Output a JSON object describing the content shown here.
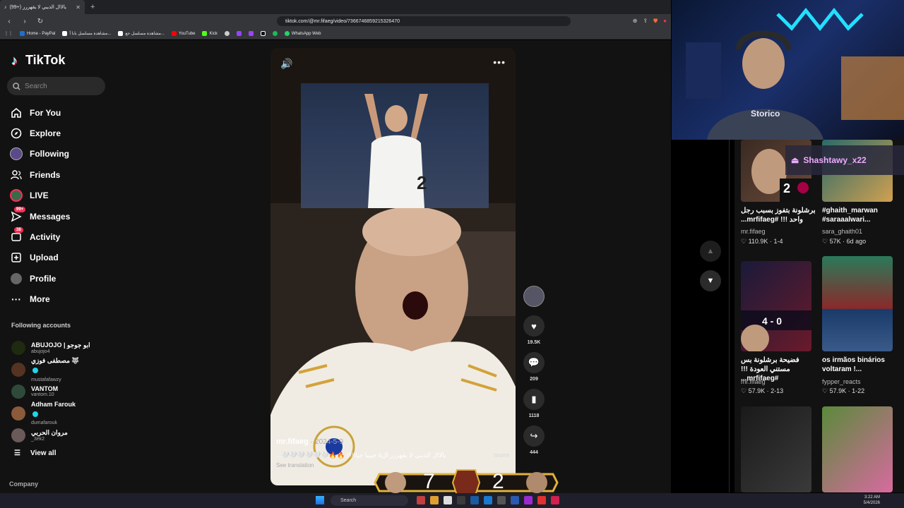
{
  "browser": {
    "tab_title": "(99+) يالاال الذيبي لا يقهررر",
    "url": "tiktok.com/@mr.fifaeg/video/7366746859215326470",
    "bookmarks": [
      "Home - PayPal",
      "مشاهدة مسلسل بابا أ...",
      "مشاهدة مسلسل جع...",
      "YouTube",
      "Kick",
      "WhatsApp Web"
    ]
  },
  "tiktok": {
    "logo_text": "TikTok",
    "search_placeholder": "Search",
    "nav": [
      {
        "label": "For You",
        "icon": "home-icon"
      },
      {
        "label": "Explore",
        "icon": "compass-icon"
      },
      {
        "label": "Following",
        "icon": "following-avatar-icon"
      },
      {
        "label": "Friends",
        "icon": "friends-icon"
      },
      {
        "label": "LIVE",
        "icon": "live-icon"
      },
      {
        "label": "Messages",
        "icon": "message-icon",
        "badge": "99+"
      },
      {
        "label": "Activity",
        "icon": "activity-icon",
        "badge": "38"
      },
      {
        "label": "Upload",
        "icon": "upload-icon"
      },
      {
        "label": "Profile",
        "icon": "profile-icon"
      },
      {
        "label": "More",
        "icon": "more-icon"
      }
    ],
    "following_title": "Following accounts",
    "following": [
      {
        "name": "ABUJOJO | ابو جوجو",
        "handle": "abujojo4",
        "verified": false,
        "color": "#1f2a10"
      },
      {
        "name": "مصطفى فوزي 🐺",
        "handle": "mustafafawzy",
        "verified": true,
        "color": "#553322"
      },
      {
        "name": "VANTOM",
        "handle": "vantom.10",
        "verified": false,
        "color": "#2f4a3a"
      },
      {
        "name": "Adham Farouk",
        "handle": "dumafarouk",
        "verified": true,
        "color": "#8a5a3a"
      },
      {
        "name": "مروان الحربي",
        "handle": "_3ek2",
        "verified": false,
        "color": "#6a5a5a"
      }
    ],
    "view_all": "View all",
    "company": "Company"
  },
  "video": {
    "author": "mr.fifaeg",
    "date": "2024-5-9",
    "description": "يالاال الذيبي لا يقهررر ال٥ جيبيا جيا!!!!! 🔥🔥🤍🤍🤍🤍🤍🤍...",
    "more": "more",
    "see_translation": "See translation",
    "likes": "19.5K",
    "comments": "209",
    "saves": "1118",
    "shares": "444"
  },
  "recommendations": [
    {
      "caption": "برشلونة بتفوز بسبب رجل واحد !!! #mrfifaeg...",
      "author": "mr.fifaeg",
      "likes": "110.9K",
      "date": "1-4"
    },
    {
      "caption": "#ghaith_marwan #saraaalwari...",
      "author": "sara_ghaith01",
      "likes": "57K",
      "date": "6d ago"
    },
    {
      "caption": "فضيحة برشلونة بس مستني العودة !!! #mrfifaeg...",
      "author": "mr.fifaeg",
      "likes": "57.9K",
      "date": "2-13"
    },
    {
      "caption": "os irmãos binários voltaram !...",
      "author": "fypper_reacts",
      "likes": "57.9K",
      "date": "1-22"
    }
  ],
  "overlay": {
    "ps_name": "Shashtawy_x22",
    "score_left": "7",
    "score_right": "2"
  },
  "taskbar": {
    "search": "Search",
    "time": "3:22 AM",
    "date": "5/4/2026"
  }
}
